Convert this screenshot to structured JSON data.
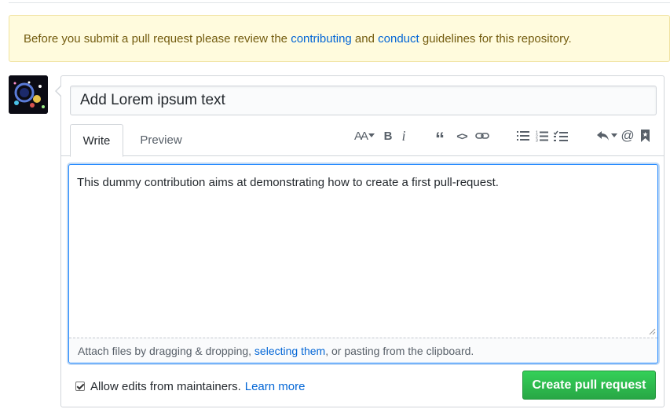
{
  "flash": {
    "prefix": "Before you submit a pull request please review the ",
    "link1": "contributing",
    "middle": " and ",
    "link2": "conduct",
    "suffix": " guidelines for this repository."
  },
  "form": {
    "title_value": "Add Lorem ipsum text",
    "tabs": {
      "write": "Write",
      "preview": "Preview"
    },
    "toolbar": {
      "header_label": "AA",
      "bold_label": "B",
      "italic_label": "i",
      "quote_label": "“",
      "code_label": "<>",
      "mention_label": "@"
    },
    "body_text": "This dummy contribution aims at demonstrating how to create a first pull-request.",
    "attach": {
      "prefix": "Attach files by dragging & dropping, ",
      "link": "selecting them",
      "suffix": ", or pasting from the clipboard."
    },
    "allow_edits": {
      "checked": true,
      "label": "Allow edits from maintainers.",
      "link": "Learn more"
    },
    "submit_label": "Create pull request"
  },
  "colors": {
    "link": "#0366d6",
    "button_green": "#28a745",
    "flash_bg": "#fffbdd"
  }
}
